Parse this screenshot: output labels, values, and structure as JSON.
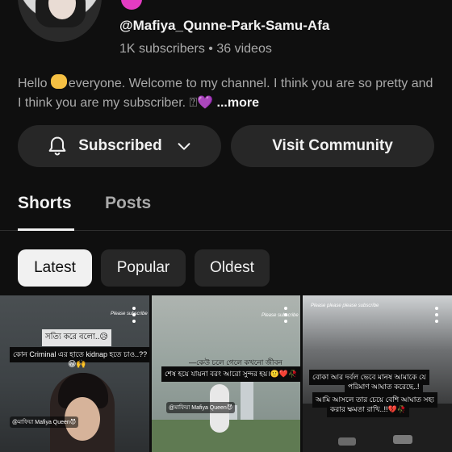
{
  "channel": {
    "handle": "@Mafiya_Qunne-Park-Samu-Afa",
    "subscribers": "1K subscribers",
    "separator": "•",
    "videos": "36 videos",
    "description_part1": "Hello ",
    "description_part2": "everyone. Welcome to my channel. I think you are so pretty and I think you are my subscriber. ",
    "description_glyph": "⍰",
    "heart": "💜",
    "more": "...more"
  },
  "buttons": {
    "subscribed": "Subscribed",
    "visit_community": "Visit Community"
  },
  "tabs": [
    {
      "label": "Shorts",
      "active": true
    },
    {
      "label": "Posts",
      "active": false
    }
  ],
  "chips": [
    {
      "label": "Latest",
      "selected": true
    },
    {
      "label": "Popular",
      "selected": false
    },
    {
      "label": "Oldest",
      "selected": false
    }
  ],
  "thumbnails": [
    {
      "corner": "Please subscribe",
      "line1": "সত্যি করে বলো..😥",
      "line2": "কোন Criminal এর হাতে kidnap হতে চাও..??",
      "line3": "😁🙌",
      "tag": "@মাফিয়া Mafiya Queen😈"
    },
    {
      "corner": "Please subscribe",
      "line1": "—কেউ চলে গেলে কখনো জীবন",
      "line2": "শেষ হয়ে যায়না বরং আরো সুন্দর হয়।🙂❤️🥀",
      "tag": "@মাফিয়া Mafiya Queen😈"
    },
    {
      "corner": "Please please please subscribe",
      "line1": "বোকা আর দুর্বল ভেবে মানুষ আমাকে যে",
      "line2": "পরিমাণ আঘাত করেছে..!",
      "line3": "আমি আসলে তার চেয়ে বেশি আঘাত সহ্য",
      "line4": "করার ক্ষমতা রাখি..!!💔🥀"
    }
  ],
  "colors": {
    "background": "#0f0f0f",
    "button_bg": "#272727",
    "secondary_text": "#aaaaaa",
    "selected_chip_bg": "#f1f1f1"
  }
}
